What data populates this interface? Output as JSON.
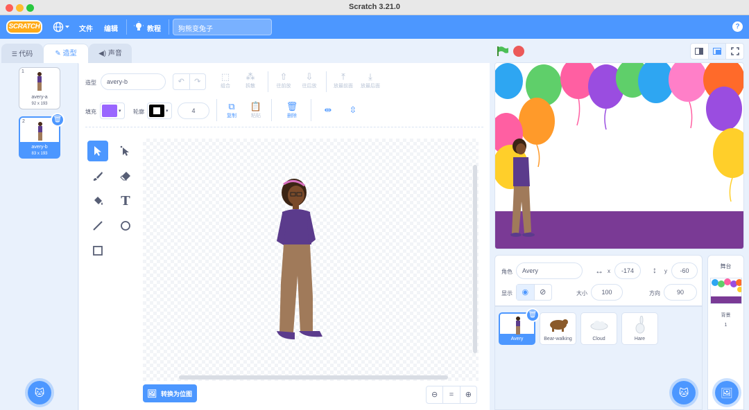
{
  "window": {
    "title": "Scratch 3.21.0"
  },
  "menu": {
    "logo": "SCRATCH",
    "file": "文件",
    "edit": "编辑",
    "tutorials": "教程",
    "project_title": "狗熊变兔子",
    "help": "?"
  },
  "tabs": [
    {
      "label": "代码"
    },
    {
      "label": "造型"
    },
    {
      "label": "声音"
    }
  ],
  "costumes": [
    {
      "num": "1",
      "name": "avery-a",
      "size": "92 x 193"
    },
    {
      "num": "2",
      "name": "avery-b",
      "size": "83 x 193"
    }
  ],
  "editor": {
    "costume_label": "造型",
    "costume_name": "avery-b",
    "group": "组合",
    "ungroup": "拆散",
    "forward": "往前放",
    "backward": "往后放",
    "front": "放最前面",
    "back": "放最后面",
    "fill_label": "填充",
    "outline_label": "轮廓",
    "outline_width": "4",
    "copy": "复制",
    "paste": "粘贴",
    "delete": "删除",
    "convert_bitmap": "转换为位图",
    "zoom_reset": "="
  },
  "colors": {
    "fill": "#9966ff",
    "outline": "#000000",
    "accent": "#4c97ff",
    "stage_floor": "#7a3a95"
  },
  "sprite_info": {
    "sprite_label": "角色",
    "sprite_name": "Avery",
    "x_label": "x",
    "x": "-174",
    "y_label": "y",
    "y": "-60",
    "show_label": "显示",
    "size_label": "大小",
    "size": "100",
    "direction_label": "方向",
    "direction": "90"
  },
  "sprites": [
    {
      "name": "Avery"
    },
    {
      "name": "Bear-walking"
    },
    {
      "name": "Cloud"
    },
    {
      "name": "Hare"
    }
  ],
  "stage_pane": {
    "title": "舞台",
    "backdrop_label": "背景",
    "backdrop_count": "1"
  }
}
